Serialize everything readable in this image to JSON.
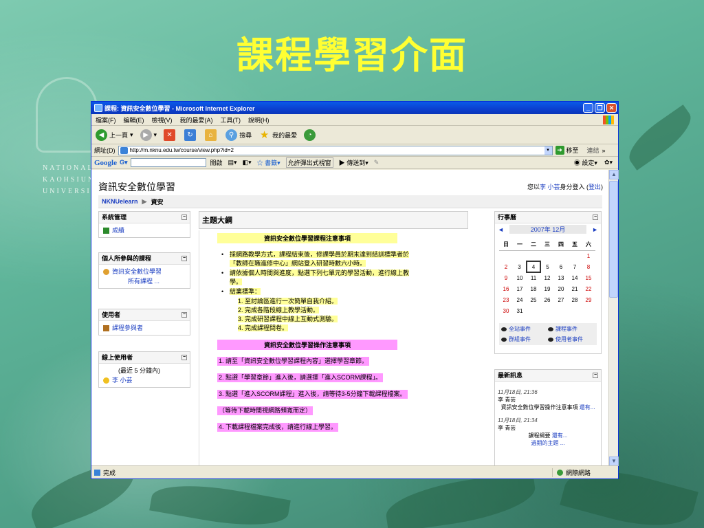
{
  "slide": {
    "title": "課程學習介面",
    "university_lines": [
      "NATIONAL",
      "KAOHSIUNG",
      "UNIVERSITY"
    ]
  },
  "browser": {
    "window_title": "課程: 資訊安全數位學習 - Microsoft Internet Explorer",
    "menu": [
      "檔案(F)",
      "編輯(E)",
      "檢視(V)",
      "我的最愛(A)",
      "工具(T)",
      "說明(H)"
    ],
    "toolbar": {
      "back": "上一頁",
      "search": "搜尋",
      "favorites": "我的最愛"
    },
    "address_label": "網址(D)",
    "address_value": "http://m.nknu.edu.tw/course/view.php?id=2",
    "go_label": "移至",
    "links_label": "連結",
    "google": {
      "logo": "Google",
      "g_menu": "G▾",
      "go": "開啟",
      "bookmarks": "書籤▾",
      "popups": "允許彈出式視窗",
      "send_to": "傳送到▾",
      "settings": "設定▾"
    },
    "status_text": "完成",
    "status_zone": "網際網路"
  },
  "page": {
    "site_title": "資訊安全數位學習",
    "login": {
      "prefix": "您以",
      "user": "李 小芸",
      "middle": "身分登入 (",
      "logout": "登出",
      "suffix": ")"
    },
    "breadcrumb": {
      "home": "NKNUelearn",
      "sep": "▶",
      "current": "資安"
    },
    "blocks": {
      "admin": {
        "title": "系統管理",
        "items": [
          "成績"
        ]
      },
      "courses": {
        "title": "個人所參與的課程",
        "items": [
          "資訊安全數位學習",
          "所有課程 ..."
        ]
      },
      "people": {
        "title": "使用者",
        "items": [
          "課程參與者"
        ]
      },
      "online": {
        "title": "線上使用者",
        "note": "(最近 5 分鐘內)",
        "user": "李 小芸"
      }
    },
    "main": {
      "heading": "主題大綱",
      "section1_title": "資訊安全數位學習課程注意事項",
      "bullets": [
        "採網路教學方式，課程結束後，修課學員於期末達到結訓標準者於",
        "「教師在職進修中心」網站登入研習時數六小時。",
        "請依據個人時間與進度，點選下列七單元的學習活動，進行線上教",
        "學。",
        "結業標準："
      ],
      "criteria": [
        "1. 至討論區進行一次簡單自我介紹。",
        "2. 完成各階段線上教學活動。",
        "3. 完成研習課程中線上互動式測驗。",
        "4. 完成課程問卷。"
      ],
      "section2_title": "資訊安全數位學習操作注意事項",
      "steps": [
        "1. 請至「資訊安全數位學習課程內容」選擇學習章節。",
        "2. 點選「學習章節」進入後，請選擇「進入SCORM課程」。",
        "3. 點選「進入SCORM課程」進入後，請等待3-5分鐘下載課程檔案。",
        "（等待下載時間視網路頻寬而定）",
        "4. 下載課程檔案完成後，請進行線上學習。"
      ]
    },
    "calendar": {
      "title": "行事曆",
      "prev": "◄",
      "next": "►",
      "month": "2007年 12月",
      "weekdays": [
        "日",
        "一",
        "二",
        "三",
        "四",
        "五",
        "六"
      ],
      "weeks": [
        [
          "",
          "",
          "",
          "",
          "",
          "",
          "1"
        ],
        [
          "2",
          "3",
          "4",
          "5",
          "6",
          "7",
          "8"
        ],
        [
          "9",
          "10",
          "11",
          "12",
          "13",
          "14",
          "15"
        ],
        [
          "16",
          "17",
          "18",
          "19",
          "20",
          "21",
          "22"
        ],
        [
          "23",
          "24",
          "25",
          "26",
          "27",
          "28",
          "29"
        ],
        [
          "30",
          "31",
          "",
          "",
          "",
          "",
          ""
        ]
      ],
      "today": "4",
      "legend": [
        "全站事件",
        "課程事件",
        "群組事件",
        "使用者事件"
      ]
    },
    "news": {
      "title": "最新訊息",
      "items": [
        {
          "date": "11月18日, 21:36",
          "author": "李 青芸",
          "text": "資訊安全數位學習操作注意事項",
          "more": "還有..."
        },
        {
          "date": "11月18日, 21:34",
          "author": "李 青芸",
          "text": "課程綱要",
          "more": "還有..."
        }
      ],
      "older": "過期的主題 ..."
    }
  }
}
